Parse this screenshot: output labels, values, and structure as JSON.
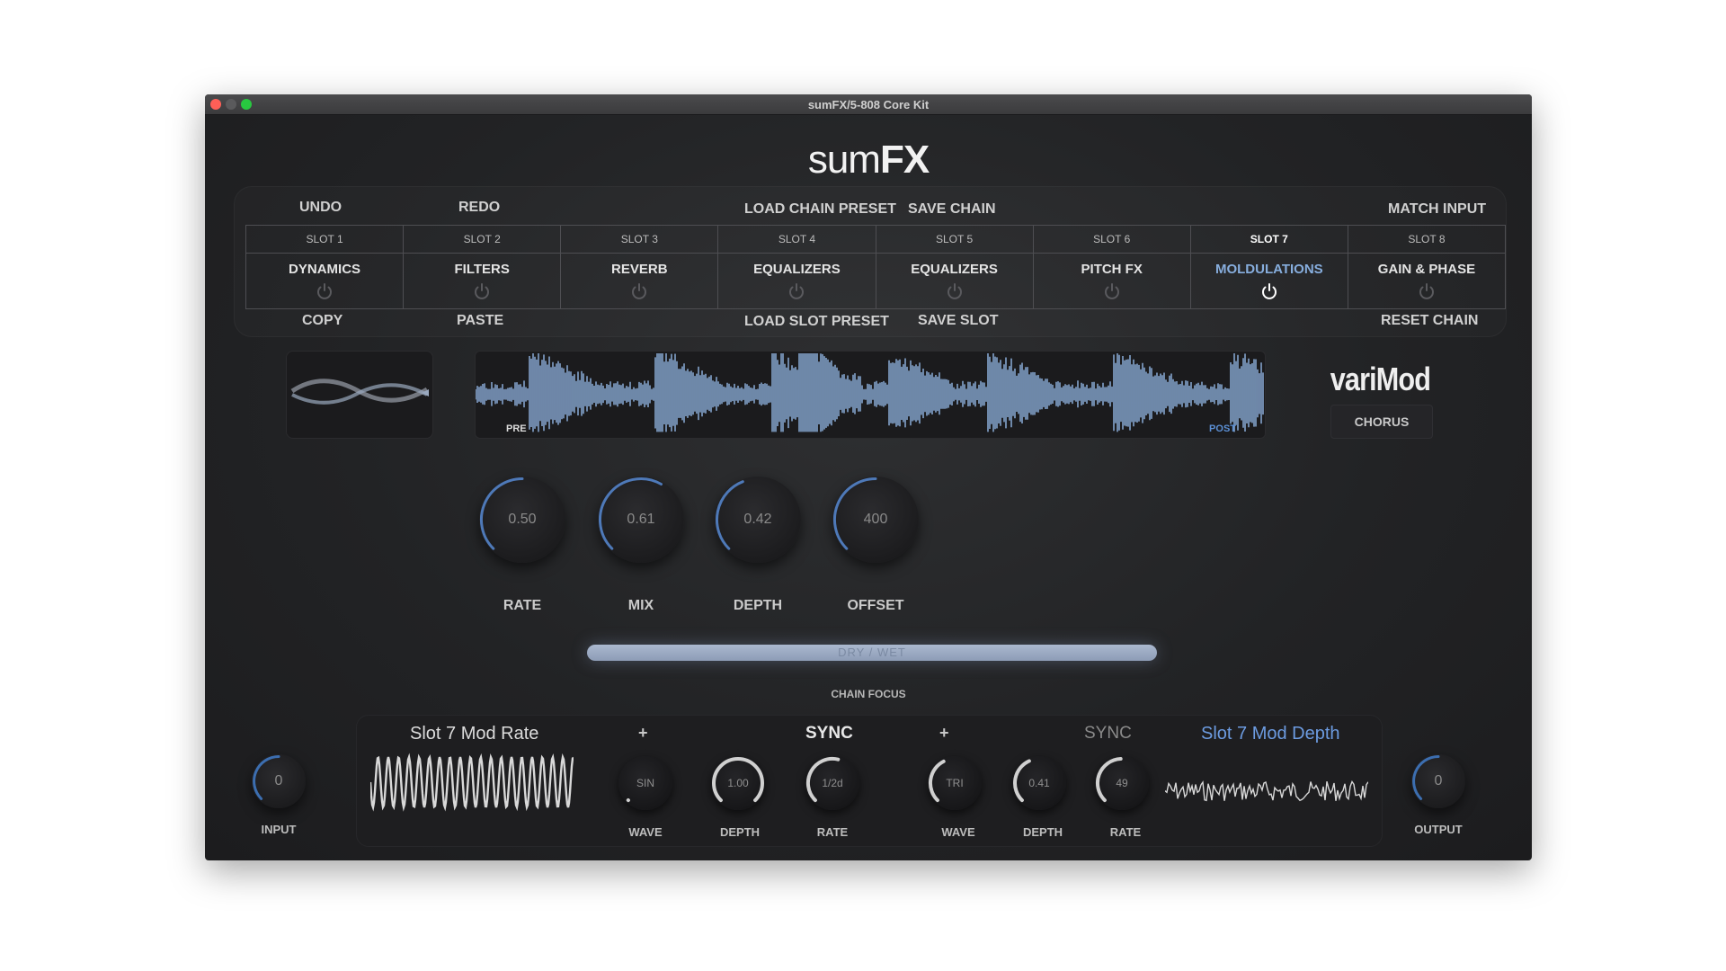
{
  "window": {
    "title": "sumFX/5-808 Core Kit",
    "colors": {
      "close": "#ff5f57",
      "minimize": "#febc2e",
      "zoom": "#28c840",
      "accent": "#87aede"
    }
  },
  "brand": {
    "bold": "sum",
    "strong": "FX"
  },
  "chain_controls": {
    "undo": "UNDO",
    "redo": "REDO",
    "load_chain_preset": "LOAD CHAIN PRESET",
    "save_chain": "SAVE CHAIN",
    "match_input": "MATCH INPUT",
    "copy": "COPY",
    "paste": "PASTE",
    "load_slot_preset": "LOAD SLOT PRESET",
    "save_slot": "SAVE SLOT",
    "reset_chain": "RESET CHAIN"
  },
  "slots": [
    {
      "slot": "SLOT 1",
      "fx": "DYNAMICS",
      "active": false
    },
    {
      "slot": "SLOT 2",
      "fx": "FILTERS",
      "active": false
    },
    {
      "slot": "SLOT 3",
      "fx": "REVERB",
      "active": false
    },
    {
      "slot": "SLOT 4",
      "fx": "EQUALIZERS",
      "active": false
    },
    {
      "slot": "SLOT 5",
      "fx": "EQUALIZERS",
      "active": false
    },
    {
      "slot": "SLOT 6",
      "fx": "PITCH FX",
      "active": false
    },
    {
      "slot": "SLOT 7",
      "fx": "MOLDULATIONS",
      "active": true
    },
    {
      "slot": "SLOT 8",
      "fx": "GAIN & PHASE",
      "active": false
    }
  ],
  "waveform": {
    "pre_label": "PRE",
    "post_label": "POST"
  },
  "effect": {
    "name": "variMod",
    "mode": "CHORUS"
  },
  "main_knobs": [
    {
      "label": "RATE",
      "value": "0.50",
      "level": 0.5
    },
    {
      "label": "MIX",
      "value": "0.61",
      "level": 0.61
    },
    {
      "label": "DEPTH",
      "value": "0.42",
      "level": 0.42
    },
    {
      "label": "OFFSET",
      "value": "400",
      "level": 0.5
    }
  ],
  "dry_wet": {
    "label": "DRY / WET",
    "level": 1.0
  },
  "chain_focus": "CHAIN FOCUS",
  "io": {
    "input": {
      "label": "INPUT",
      "value": "0",
      "level": 0.5
    },
    "output": {
      "label": "OUTPUT",
      "value": "0",
      "level": 0.5
    }
  },
  "mod_rate": {
    "title": "Slot 7 Mod Rate",
    "plus": "+",
    "sync": "SYNC",
    "knobs": [
      {
        "label": "WAVE",
        "value": "SIN",
        "level": 0
      },
      {
        "label": "DEPTH",
        "value": "1.00",
        "level": 1.0
      },
      {
        "label": "RATE",
        "value": "1/2d",
        "level": 0.55
      }
    ]
  },
  "mod_depth": {
    "title": "Slot 7 Mod Depth",
    "plus": "+",
    "sync": "SYNC",
    "knobs": [
      {
        "label": "WAVE",
        "value": "TRI",
        "level": 0.4
      },
      {
        "label": "DEPTH",
        "value": "0.41",
        "level": 0.41
      },
      {
        "label": "RATE",
        "value": "49",
        "level": 0.49
      }
    ]
  }
}
